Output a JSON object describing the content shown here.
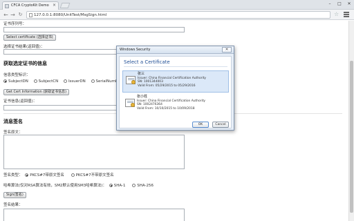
{
  "browser": {
    "tab_title": "CFCA CryptoKit Demo",
    "tab_close": "×",
    "address": "127.0.0.1:8080/UnitTest/MsgSign.html",
    "back_icon": "back-arrow-icon",
    "forward_icon": "forward-arrow-icon",
    "reload_icon": "reload-icon",
    "window_controls": {
      "minimize": "–",
      "maximize": "□",
      "close": "✕"
    }
  },
  "page": {
    "sn_label": "证书序列号：",
    "select_cert_button": "Select certificate (选择证书)",
    "select_result_label": "选择证书结果(返回值)：",
    "get_info_heading": "获取选定证书的信息",
    "info_type_label": "信息类型标识：",
    "info_types": [
      {
        "label": "SubjectDN",
        "checked": true
      },
      {
        "label": "SubjectCN",
        "checked": false
      },
      {
        "label": "IssuerDN",
        "checked": false
      },
      {
        "label": "SerialNumbe",
        "checked": false
      }
    ],
    "get_info_button": "Get Cert Information (获取证书信息)",
    "cert_info_label": "证书信息(返回值)：",
    "sign_heading": "消息签名",
    "sign_source_label": "签名原文：",
    "sign_type_label": "签名类型：",
    "sign_types": [
      {
        "label": "PKCS#7带原文签名",
        "checked": true
      },
      {
        "label": "PKCS#7不带原文签名",
        "checked": false
      }
    ],
    "hash_label": "哈希算法(仅对RSA算法有效，SM2默认使用SM3哈希算法)：",
    "hash_options": [
      {
        "label": "SHA-1",
        "checked": true
      },
      {
        "label": "SHA-256",
        "checked": false
      }
    ],
    "sign_button": "Sign(签名)",
    "sign_result_label": "签名结果："
  },
  "dialog": {
    "window_title": "Windows Security",
    "close_label": "✕",
    "heading": "Select a Certificate",
    "certificates": [
      {
        "name": "张三",
        "issuer": "Issuer: China Financial Certification Authority",
        "sn": "SN: 1001344003",
        "valid": "Valid From: 05/29/2015 to 05/29/2016",
        "selected": true
      },
      {
        "name": "张小姓",
        "issuer": "Issuer: China Financial Certification Authority",
        "sn": "SN: 1002476364",
        "valid": "Valid From: 10/10/2015 to 10/09/2018",
        "selected": false
      }
    ],
    "ok_button": "OK",
    "cancel_button": "Cancel"
  }
}
